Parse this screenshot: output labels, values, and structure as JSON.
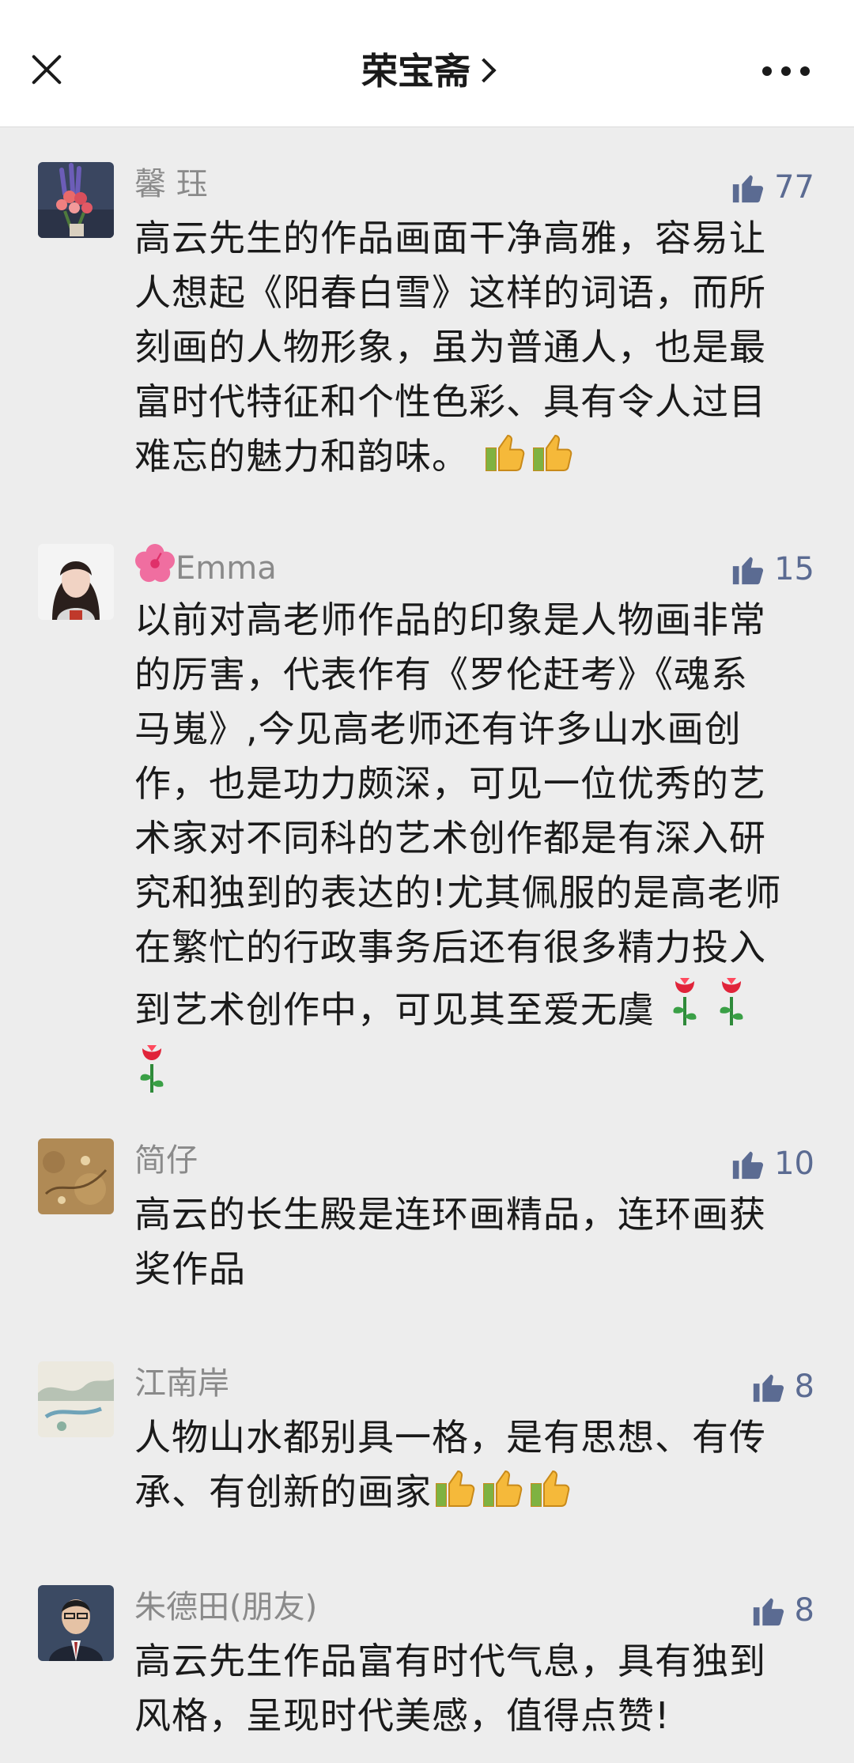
{
  "header": {
    "title": "荣宝斋"
  },
  "comments": [
    {
      "name": "馨 珏",
      "likes": "77",
      "text": "高云先生的作品画面干净高雅，容易让\n人想起《阳春白雪》这样的词语，而所\n刻画的人物形象，虽为普通人，也是最\n富时代特征和个性色彩、具有令人过目\n难忘的魅力和韵味。",
      "emojis": [
        "thumbs-up",
        "thumbs-up"
      ]
    },
    {
      "name": "Emma",
      "name_prefix_icon": "hibiscus-flower",
      "likes": "15",
      "text": "以前对高老师作品的印象是人物画非常\n的厉害，代表作有《罗伦赶考》《魂系\n马嵬》,今见高老师还有许多山水画创\n作，也是功力颇深，可见一位优秀的艺\n术家对不同科的艺术创作都是有深入研\n究和独到的表达的!尤其佩服的是高老师\n在繁忙的行政事务后还有很多精力投入\n到艺术创作中，可见其至爱无虞",
      "emojis": [
        "rose",
        "rose",
        "rose"
      ]
    },
    {
      "name": "简仔",
      "likes": "10",
      "text": "高云的长生殿是连环画精品，连环画获\n奖作品",
      "emojis": []
    },
    {
      "name": "江南岸",
      "likes": "8",
      "text": "人物山水都别具一格，是有思想、有传\n承、有创新的画家",
      "emojis": [
        "thumbs-up",
        "thumbs-up",
        "thumbs-up"
      ]
    },
    {
      "name": "朱德田(朋友)",
      "likes": "8",
      "text": "高云先生作品富有时代气息，具有独到\n风格，呈现时代美感，值得点赞!",
      "emojis": []
    }
  ]
}
